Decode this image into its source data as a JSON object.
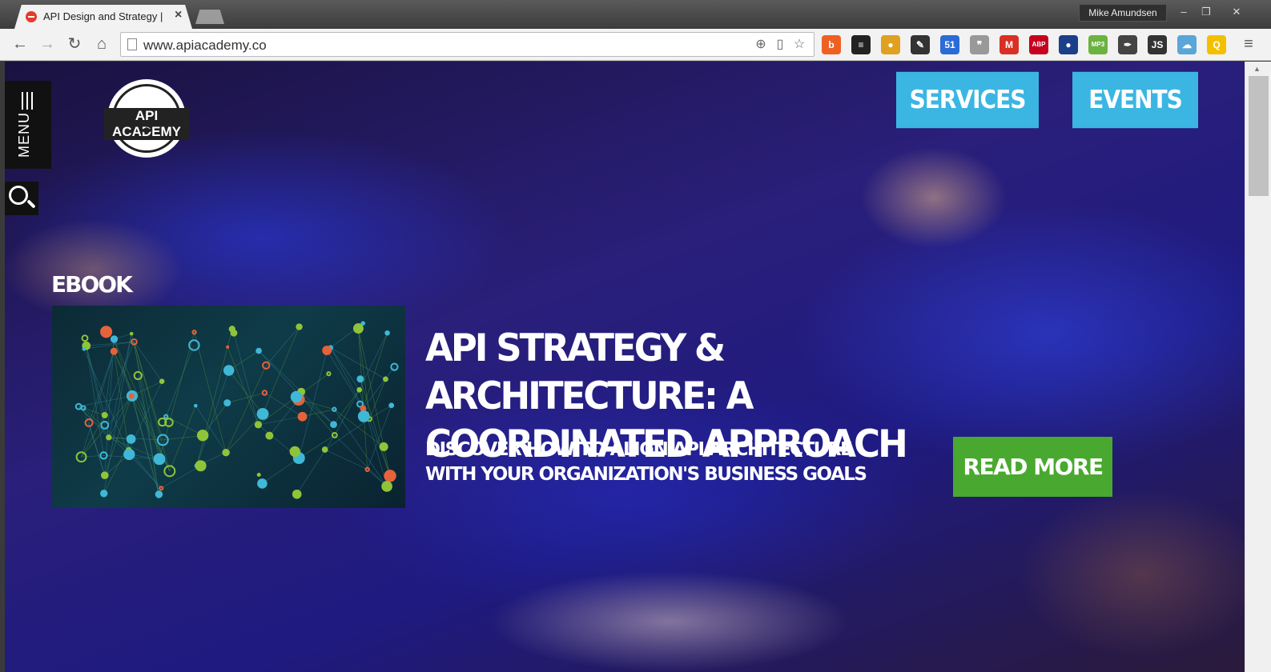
{
  "browser": {
    "tab_title": "API Design and Strategy | ",
    "tab_close": "×",
    "user_name": "Mike Amundsen",
    "window_buttons": [
      "–",
      "❐",
      "✕"
    ],
    "url": "www.apiacademy.co",
    "nav": {
      "back": "←",
      "forward": "→",
      "reload": "↻",
      "home": "⌂"
    },
    "extensions": [
      {
        "name": "bitly-icon",
        "glyph": "b",
        "color": "#ee6123"
      },
      {
        "name": "buffer-icon",
        "glyph": "≡",
        "color": "#222222"
      },
      {
        "name": "colorpicker-icon",
        "glyph": "●",
        "color": "#e0a020"
      },
      {
        "name": "eyedropper-icon",
        "glyph": "✎",
        "color": "#333333"
      },
      {
        "name": "badge-extension-icon",
        "glyph": "51",
        "color": "#2a6bd6"
      },
      {
        "name": "speech-bubble-icon",
        "glyph": "❞",
        "color": "#999999"
      },
      {
        "name": "gmail-icon",
        "glyph": "M",
        "color": "#d93025"
      },
      {
        "name": "adblock-icon",
        "glyph": "ABP",
        "color": "#c7001f"
      },
      {
        "name": "globe-icon",
        "glyph": "●",
        "color": "#1c3f8a"
      },
      {
        "name": "mp3-icon",
        "glyph": "MP3",
        "color": "#6bb33f"
      },
      {
        "name": "feather-icon",
        "glyph": "✒",
        "color": "#444444"
      },
      {
        "name": "js-icon",
        "glyph": "JS",
        "color": "#333333"
      },
      {
        "name": "weather-icon",
        "glyph": "☁",
        "color": "#5aa6d6"
      },
      {
        "name": "q-icon",
        "glyph": "Q",
        "color": "#f3c000"
      }
    ],
    "menu_glyph": "≡"
  },
  "page": {
    "menu_label": "MENU",
    "logo_text": "API ACADEMY",
    "services_label": "SERVICES",
    "events_label": "EVENTS",
    "ebook_label": "EBOOK",
    "headline": "API STRATEGY & ARCHITECTURE: A COORDINATED APPROACH",
    "subhead": "DISCOVER HOW TO ALIGN API ARCHITECTURE WITH YOUR ORGANIZATION'S BUSINESS GOALS",
    "read_more_label": "READ MORE"
  },
  "colors": {
    "cta_blue": "#3bb6e3",
    "read_more_green": "#49a830"
  }
}
